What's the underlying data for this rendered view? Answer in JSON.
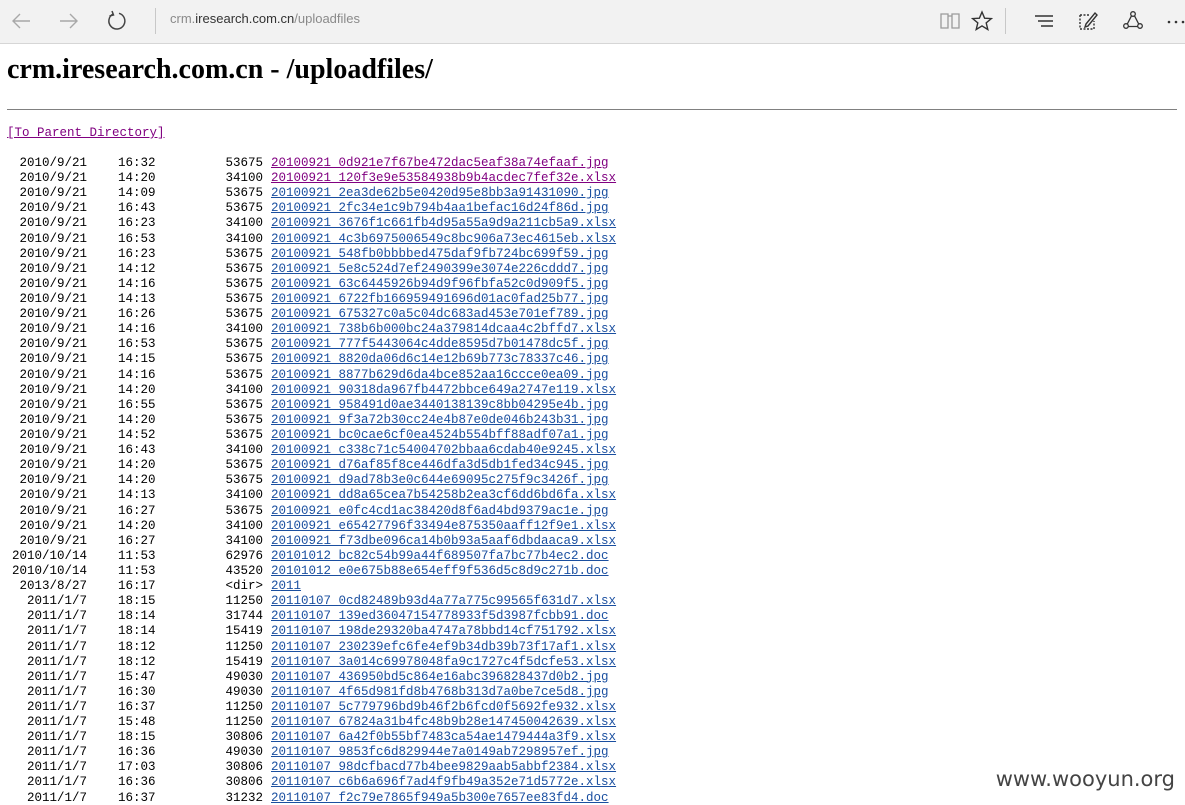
{
  "browser": {
    "url_host": "crm.iresearch.com.cn",
    "url_prefix": "crm.",
    "url_domain": "iresearch.com.cn",
    "url_path": "/uploadfiles",
    "icons": [
      "back-icon",
      "forward-icon",
      "refresh-icon",
      "reading-view-icon",
      "favorite-star-icon",
      "hub-icon",
      "web-note-icon",
      "share-icon",
      "more-icon"
    ]
  },
  "page": {
    "title": "crm.iresearch.com.cn - /uploadfiles/",
    "parent_link": "[To Parent Directory]",
    "link_color": "#1a4fa0",
    "visited_color": "#800080"
  },
  "files": [
    {
      "date": "2010/9/21",
      "time": "16:32",
      "size": "53675",
      "name": "20100921_0d921e7f67be472dac5eaf38a74efaaf.jpg",
      "visited": true
    },
    {
      "date": "2010/9/21",
      "time": "14:20",
      "size": "34100",
      "name": "20100921_120f3e9e53584938b9b4acdec7fef32e.xlsx",
      "visited": true
    },
    {
      "date": "2010/9/21",
      "time": "14:09",
      "size": "53675",
      "name": "20100921_2ea3de62b5e0420d95e8bb3a91431090.jpg",
      "visited": false
    },
    {
      "date": "2010/9/21",
      "time": "16:43",
      "size": "53675",
      "name": "20100921_2fc34e1c9b794b4aa1befac16d24f86d.jpg",
      "visited": false
    },
    {
      "date": "2010/9/21",
      "time": "16:23",
      "size": "34100",
      "name": "20100921_3676f1c661fb4d95a55a9d9a211cb5a9.xlsx",
      "visited": false
    },
    {
      "date": "2010/9/21",
      "time": "16:53",
      "size": "34100",
      "name": "20100921_4c3b6975006549c8bc906a73ec4615eb.xlsx",
      "visited": false
    },
    {
      "date": "2010/9/21",
      "time": "16:23",
      "size": "53675",
      "name": "20100921_548fb0bbbbed475daf9fb724bc699f59.jpg",
      "visited": false
    },
    {
      "date": "2010/9/21",
      "time": "14:12",
      "size": "53675",
      "name": "20100921_5e8c524d7ef2490399e3074e226cddd7.jpg",
      "visited": false
    },
    {
      "date": "2010/9/21",
      "time": "14:16",
      "size": "53675",
      "name": "20100921_63c6445926b94d9f96fbfa52c0d909f5.jpg",
      "visited": false
    },
    {
      "date": "2010/9/21",
      "time": "14:13",
      "size": "53675",
      "name": "20100921_6722fb166959491696d01ac0fad25b77.jpg",
      "visited": false
    },
    {
      "date": "2010/9/21",
      "time": "16:26",
      "size": "53675",
      "name": "20100921_675327c0a5c04dc683ad453e701ef789.jpg",
      "visited": false
    },
    {
      "date": "2010/9/21",
      "time": "14:16",
      "size": "34100",
      "name": "20100921_738b6b000bc24a379814dcaa4c2bffd7.xlsx",
      "visited": false
    },
    {
      "date": "2010/9/21",
      "time": "16:53",
      "size": "53675",
      "name": "20100921_777f5443064c4dde8595d7b01478dc5f.jpg",
      "visited": false
    },
    {
      "date": "2010/9/21",
      "time": "14:15",
      "size": "53675",
      "name": "20100921_8820da06d6c14e12b69b773c78337c46.jpg",
      "visited": false
    },
    {
      "date": "2010/9/21",
      "time": "14:16",
      "size": "53675",
      "name": "20100921_8877b629d6da4bce852aa16ccce0ea09.jpg",
      "visited": false
    },
    {
      "date": "2010/9/21",
      "time": "14:20",
      "size": "34100",
      "name": "20100921_90318da967fb4472bbce649a2747e119.xlsx",
      "visited": false
    },
    {
      "date": "2010/9/21",
      "time": "16:55",
      "size": "53675",
      "name": "20100921_958491d0ae3440138139c8bb04295e4b.jpg",
      "visited": false
    },
    {
      "date": "2010/9/21",
      "time": "14:20",
      "size": "53675",
      "name": "20100921_9f3a72b30cc24e4b87e0de046b243b31.jpg",
      "visited": false
    },
    {
      "date": "2010/9/21",
      "time": "14:52",
      "size": "53675",
      "name": "20100921_bc0cae6cf0ea4524b554bff88adf07a1.jpg",
      "visited": false
    },
    {
      "date": "2010/9/21",
      "time": "16:43",
      "size": "34100",
      "name": "20100921_c338c71c54004702bbaa6cdab40e9245.xlsx",
      "visited": false
    },
    {
      "date": "2010/9/21",
      "time": "14:20",
      "size": "53675",
      "name": "20100921_d76af85f8ce446dfa3d5db1fed34c945.jpg",
      "visited": false
    },
    {
      "date": "2010/9/21",
      "time": "14:20",
      "size": "53675",
      "name": "20100921_d9ad78b3e0c644e69095c275f9c3426f.jpg",
      "visited": false
    },
    {
      "date": "2010/9/21",
      "time": "14:13",
      "size": "34100",
      "name": "20100921_dd8a65cea7b54258b2ea3cf6dd6bd6fa.xlsx",
      "visited": false
    },
    {
      "date": "2010/9/21",
      "time": "16:27",
      "size": "53675",
      "name": "20100921_e0fc4cd1ac38420d8f6ad4bd9379ac1e.jpg",
      "visited": false
    },
    {
      "date": "2010/9/21",
      "time": "14:20",
      "size": "34100",
      "name": "20100921_e65427796f33494e875350aaff12f9e1.xlsx",
      "visited": false
    },
    {
      "date": "2010/9/21",
      "time": "16:27",
      "size": "34100",
      "name": "20100921_f73dbe096ca14b0b93a5aaf6dbdaaca9.xlsx",
      "visited": false
    },
    {
      "date": "2010/10/14",
      "time": "11:53",
      "size": "62976",
      "name": "20101012_bc82c54b99a44f689507fa7bc77b4ec2.doc",
      "visited": false
    },
    {
      "date": "2010/10/14",
      "time": "11:53",
      "size": "43520",
      "name": "20101012_e0e675b88e654eff9f536d5c8d9c271b.doc",
      "visited": false
    },
    {
      "date": "2013/8/27",
      "time": "16:17",
      "size": "<dir>",
      "name": "2011",
      "visited": false
    },
    {
      "date": "2011/1/7",
      "time": "18:15",
      "size": "11250",
      "name": "20110107_0cd82489b93d4a77a775c99565f631d7.xlsx",
      "visited": false
    },
    {
      "date": "2011/1/7",
      "time": "18:14",
      "size": "31744",
      "name": "20110107_139ed36047154778933f5d3987fcbb91.doc",
      "visited": false
    },
    {
      "date": "2011/1/7",
      "time": "18:14",
      "size": "15419",
      "name": "20110107_198de29320ba4747a78bbd14cf751792.xlsx",
      "visited": false
    },
    {
      "date": "2011/1/7",
      "time": "18:12",
      "size": "11250",
      "name": "20110107_230239efc6fe4ef9b34db39b73f17af1.xlsx",
      "visited": false
    },
    {
      "date": "2011/1/7",
      "time": "18:12",
      "size": "15419",
      "name": "20110107_3a014c69978048fa9c1727c4f5dcfe53.xlsx",
      "visited": false
    },
    {
      "date": "2011/1/7",
      "time": "15:47",
      "size": "49030",
      "name": "20110107_436950bd5c864e16abc396828437d0b2.jpg",
      "visited": false
    },
    {
      "date": "2011/1/7",
      "time": "16:30",
      "size": "49030",
      "name": "20110107_4f65d981fd8b4768b313d7a0be7ce5d8.jpg",
      "visited": false
    },
    {
      "date": "2011/1/7",
      "time": "16:37",
      "size": "11250",
      "name": "20110107_5c779796bd9b46f2b6fcd0f5692fe932.xlsx",
      "visited": false
    },
    {
      "date": "2011/1/7",
      "time": "15:48",
      "size": "11250",
      "name": "20110107_67824a31b4fc48b9b28e147450042639.xlsx",
      "visited": false
    },
    {
      "date": "2011/1/7",
      "time": "18:15",
      "size": "30806",
      "name": "20110107_6a42f0b55bf7483ca54ae1479444a3f9.xlsx",
      "visited": false
    },
    {
      "date": "2011/1/7",
      "time": "16:36",
      "size": "49030",
      "name": "20110107_9853fc6d829944e7a0149ab7298957ef.jpg",
      "visited": false
    },
    {
      "date": "2011/1/7",
      "time": "17:03",
      "size": "30806",
      "name": "20110107_98dcfbacd77b4bee9829aab5abbf2384.xlsx",
      "visited": false
    },
    {
      "date": "2011/1/7",
      "time": "16:36",
      "size": "30806",
      "name": "20110107_c6b6a696f7ad4f9fb49a352e71d5772e.xlsx",
      "visited": false
    },
    {
      "date": "2011/1/7",
      "time": "16:37",
      "size": "31232",
      "name": "20110107_f2c79e7865f949a5b300e7657ee83fd4.doc",
      "visited": false
    }
  ],
  "watermark": "www.wooyun.org"
}
